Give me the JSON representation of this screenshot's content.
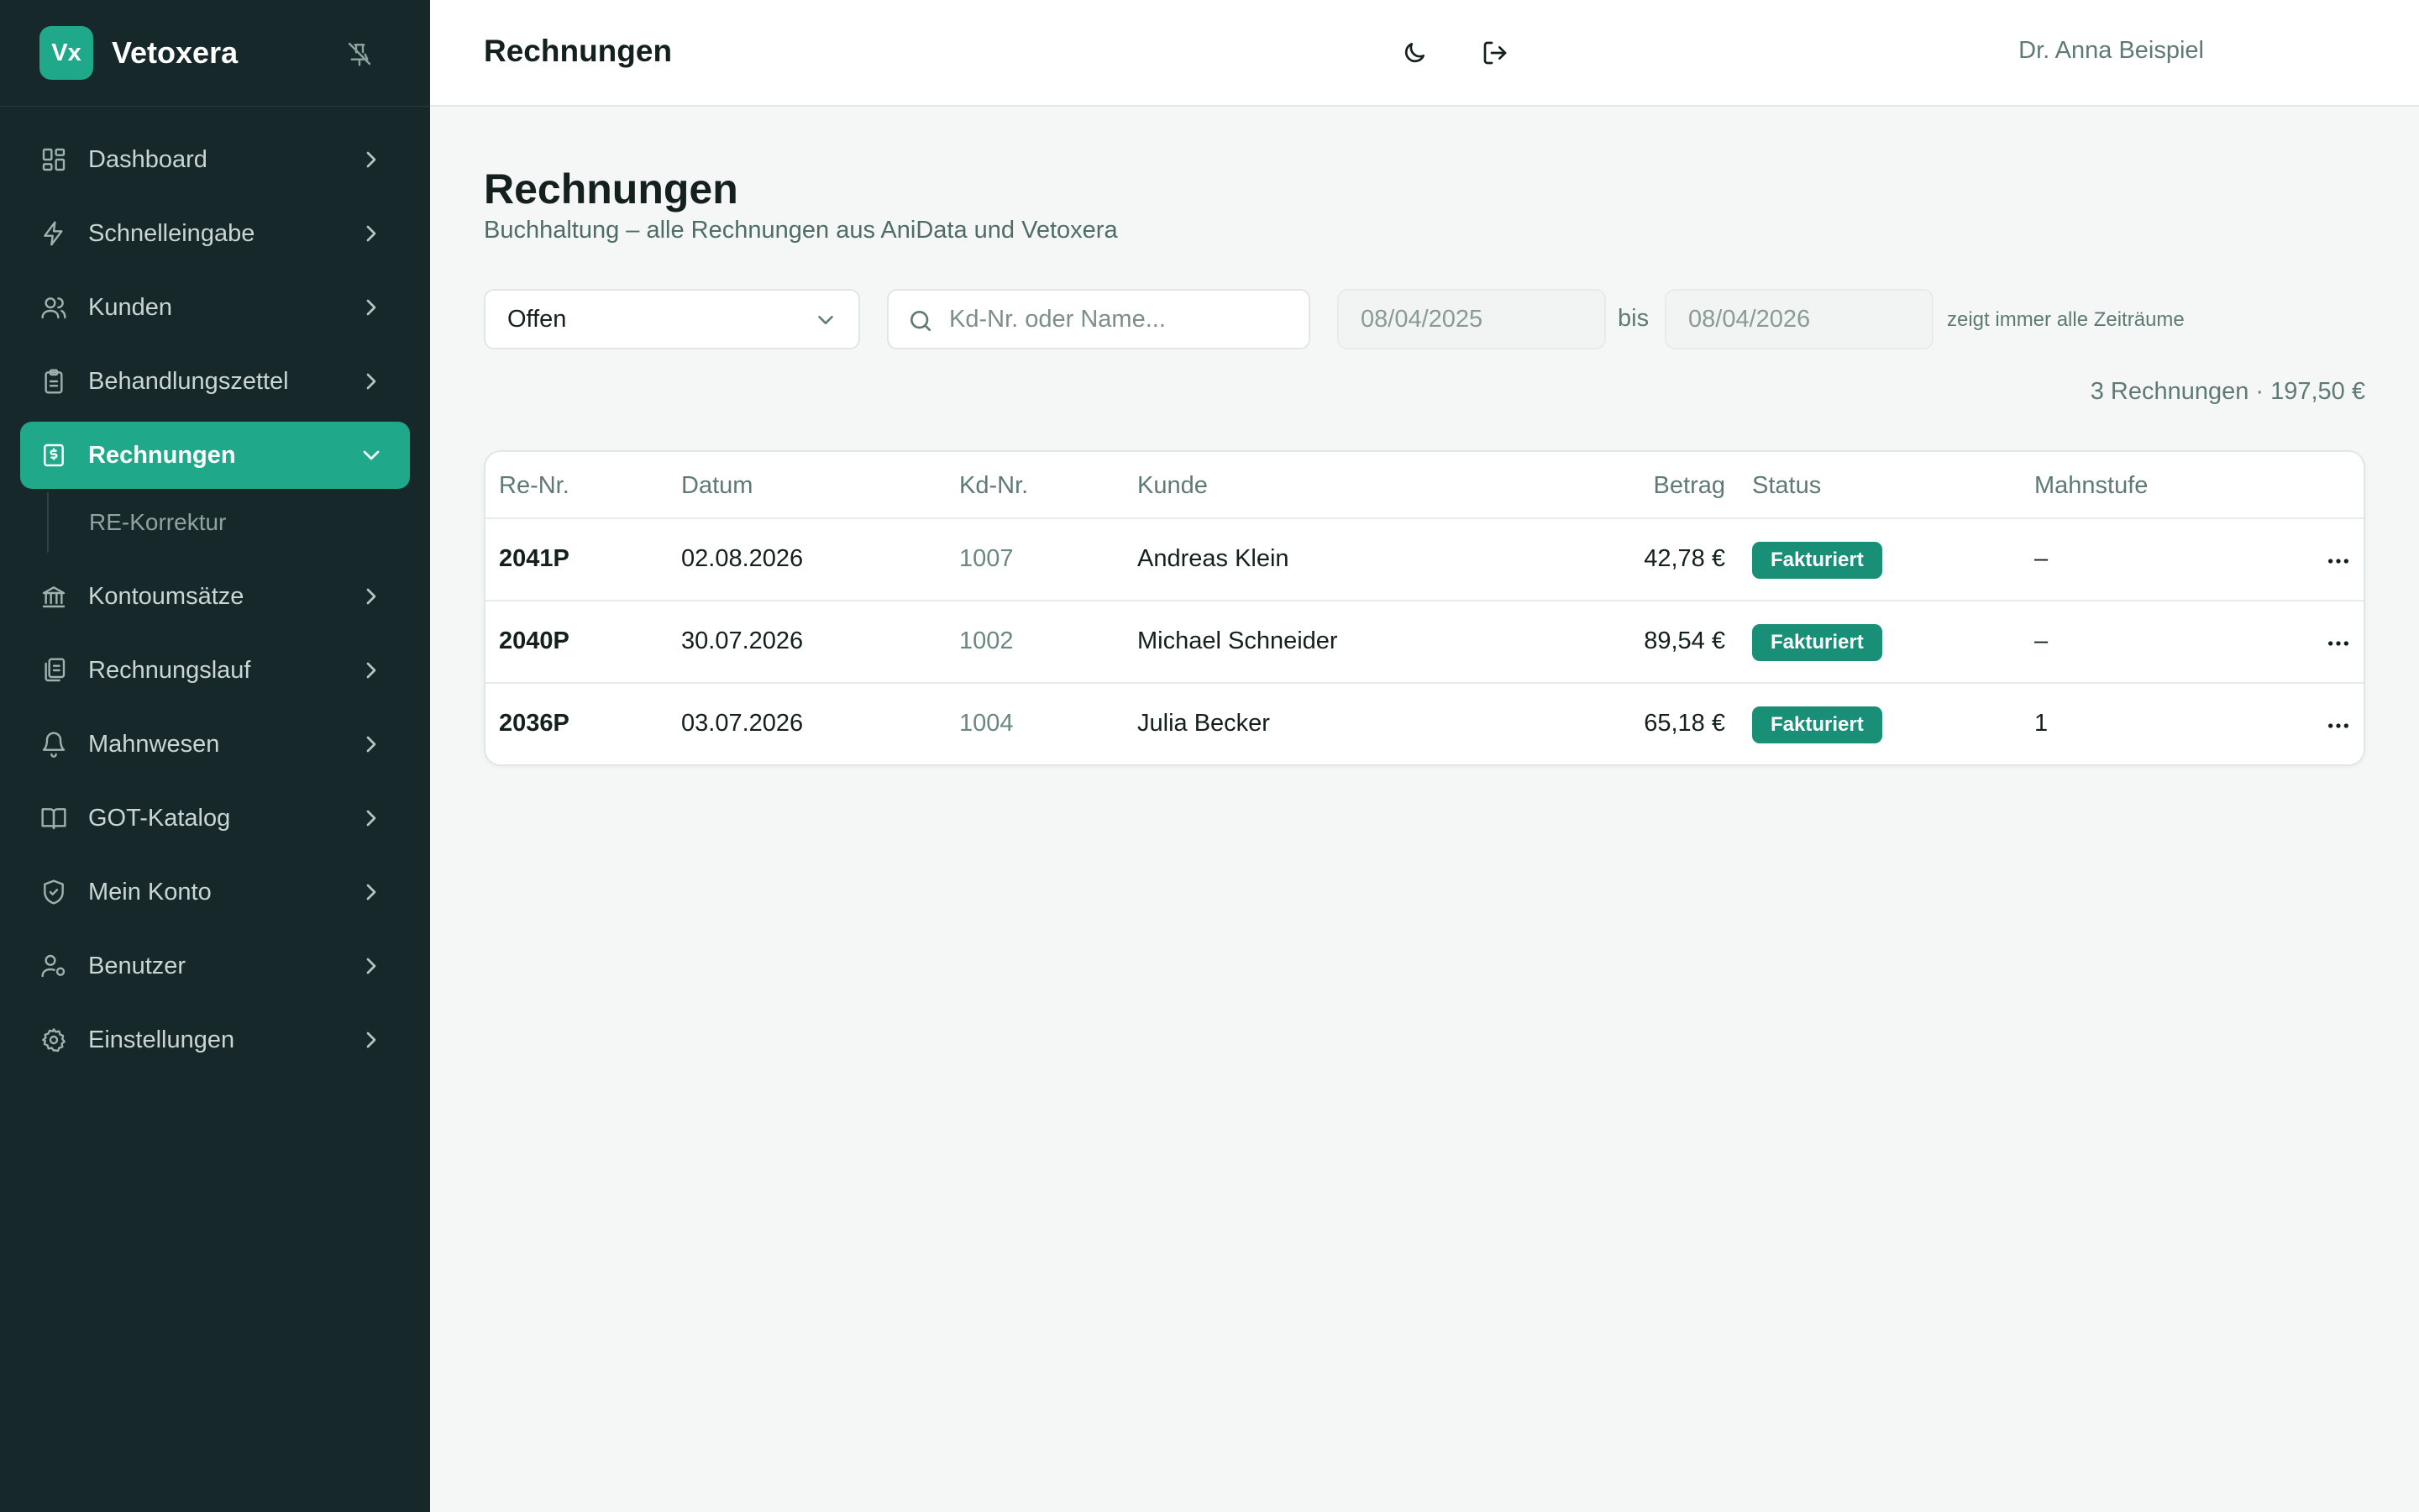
{
  "brand": {
    "logo_text": "Vx",
    "name": "Vetoxera"
  },
  "sidebar": {
    "items": [
      {
        "label": "Dashboard"
      },
      {
        "label": "Schnelleingabe"
      },
      {
        "label": "Kunden"
      },
      {
        "label": "Behandlungszettel"
      },
      {
        "label": "Rechnungen",
        "active": true
      },
      {
        "label": "Kontoumsätze"
      },
      {
        "label": "Rechnungslauf"
      },
      {
        "label": "Mahnwesen"
      },
      {
        "label": "GOT-Katalog"
      },
      {
        "label": "Mein Konto"
      },
      {
        "label": "Benutzer"
      },
      {
        "label": "Einstellungen"
      }
    ],
    "subitem": {
      "label": "RE-Korrektur"
    }
  },
  "header": {
    "title": "Rechnungen",
    "user": "Dr. Anna Beispiel"
  },
  "page": {
    "title": "Rechnungen",
    "subtitle": "Buchhaltung – alle Rechnungen aus AniData und Vetoxera"
  },
  "filters": {
    "status_value": "Offen",
    "search_placeholder": "Kd-Nr. oder Name...",
    "date_from": "08/04/2025",
    "date_sep": "bis",
    "date_to": "08/04/2026",
    "hint": "zeigt immer alle Zeiträume"
  },
  "summary": "3 Rechnungen · 197,50 €",
  "table": {
    "headers": [
      "Re-Nr.",
      "Datum",
      "Kd-Nr.",
      "Kunde",
      "Betrag",
      "Status",
      "Mahnstufe"
    ],
    "rows": [
      {
        "nr": "2041P",
        "datum": "02.08.2026",
        "kdnr": "1007",
        "kunde": "Andreas Klein",
        "betrag": "42,78 €",
        "status": "Fakturiert",
        "mahnstufe": "–"
      },
      {
        "nr": "2040P",
        "datum": "30.07.2026",
        "kdnr": "1002",
        "kunde": "Michael Schneider",
        "betrag": "89,54 €",
        "status": "Fakturiert",
        "mahnstufe": "–"
      },
      {
        "nr": "2036P",
        "datum": "03.07.2026",
        "kdnr": "1004",
        "kunde": "Julia Becker",
        "betrag": "65,18 €",
        "status": "Fakturiert",
        "mahnstufe": "1"
      }
    ]
  },
  "colors": {
    "sidebar_bg": "#16282a",
    "accent": "#1fa98a",
    "badge": "#1a8f78",
    "page_bg": "#f5f7f6"
  }
}
